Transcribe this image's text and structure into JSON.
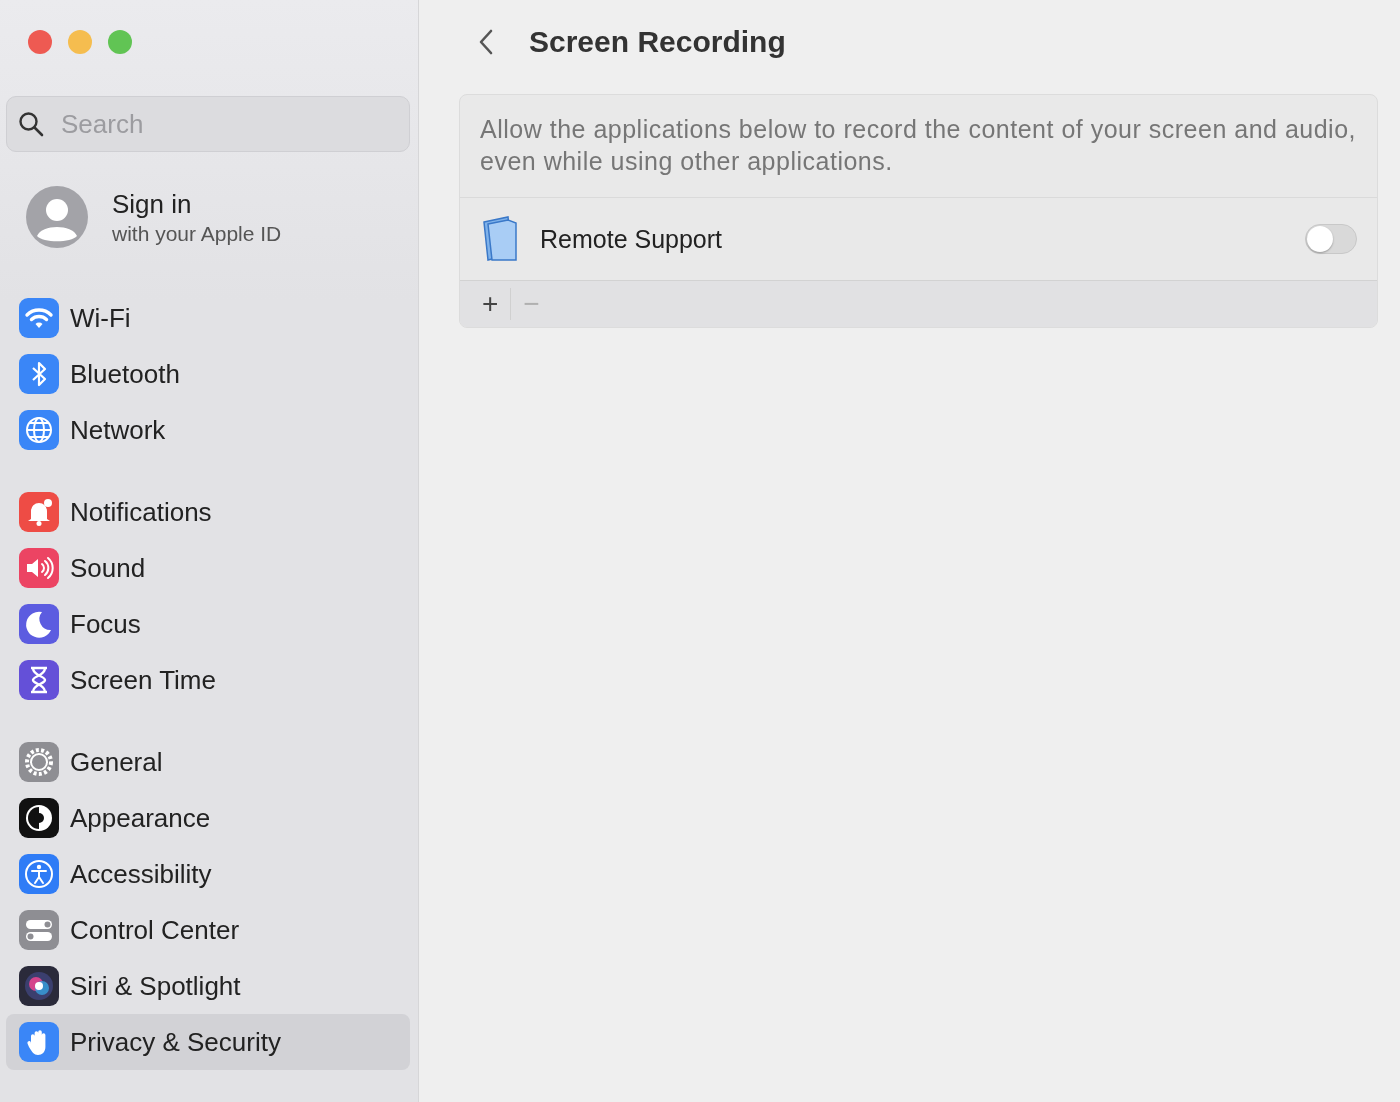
{
  "window": {
    "controls": [
      {
        "kind": "close"
      },
      {
        "kind": "minimize"
      },
      {
        "kind": "zoom"
      }
    ]
  },
  "search": {
    "placeholder": "Search"
  },
  "account": {
    "title": "Sign in",
    "subtitle": "with your Apple ID"
  },
  "sidebar": {
    "groups": [
      [
        {
          "label": "Wi-Fi",
          "kind": "wifi",
          "selected": false
        },
        {
          "label": "Bluetooth",
          "kind": "bluetooth",
          "selected": false
        },
        {
          "label": "Network",
          "kind": "globe",
          "selected": false
        }
      ],
      [
        {
          "label": "Notifications",
          "kind": "bell",
          "selected": false
        },
        {
          "label": "Sound",
          "kind": "speaker",
          "selected": false
        },
        {
          "label": "Focus",
          "kind": "moon",
          "selected": false
        },
        {
          "label": "Screen Time",
          "kind": "hourglass",
          "selected": false
        }
      ],
      [
        {
          "label": "General",
          "kind": "gear",
          "selected": false
        },
        {
          "label": "Appearance",
          "kind": "appearance",
          "selected": false
        },
        {
          "label": "Accessibility",
          "kind": "accessibility",
          "selected": false
        },
        {
          "label": "Control Center",
          "kind": "switches",
          "selected": false
        },
        {
          "label": "Siri & Spotlight",
          "kind": "siri",
          "selected": false
        },
        {
          "label": "Privacy & Security",
          "kind": "hand",
          "selected": true
        }
      ]
    ]
  },
  "page": {
    "title": "Screen Recording",
    "description": "Allow the applications below to record the content of your screen and audio, even while using other applications.",
    "apps": [
      {
        "name": "Remote Support",
        "on": false
      }
    ],
    "toolbar": [
      {
        "label": "+",
        "disabled": false
      },
      {
        "label": "−",
        "disabled": true
      }
    ]
  }
}
